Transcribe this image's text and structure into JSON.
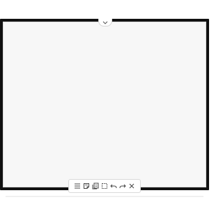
{
  "colors": {
    "bezel": "#111111",
    "canvas": "#f7f7f7",
    "toolbar_bg": "#ffffff",
    "icon": "#444444"
  },
  "top_handle": {
    "icon": "chevron-down-icon"
  },
  "toolbar": {
    "tools": [
      {
        "name": "menu",
        "icon": "menu-icon"
      },
      {
        "name": "sticky-note",
        "icon": "sticky-note-icon"
      },
      {
        "name": "documents",
        "icon": "documents-icon"
      },
      {
        "name": "select-area",
        "icon": "selection-icon"
      },
      {
        "name": "undo",
        "icon": "undo-icon"
      },
      {
        "name": "redo",
        "icon": "redo-icon"
      },
      {
        "name": "close",
        "icon": "close-icon"
      }
    ]
  }
}
